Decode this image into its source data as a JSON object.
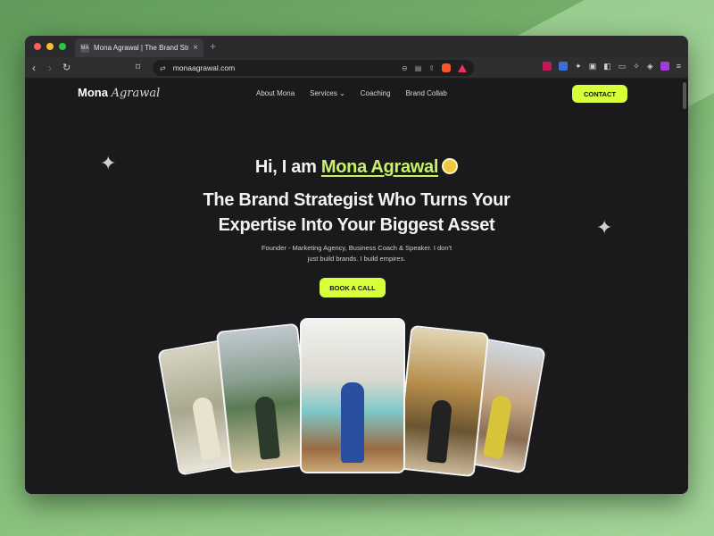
{
  "browser": {
    "tab_title": "Mona Agrawal | The Brand Strategist",
    "tab_favicon_text": "MA",
    "url": "monaagrawal.com"
  },
  "site": {
    "logo_first": "Mona",
    "logo_second": "Agrawal",
    "nav": [
      "About Mona",
      "Services ⌄",
      "Coaching",
      "Brand Collab"
    ],
    "contact_label": "CONTACT"
  },
  "hero": {
    "greeting": "Hi, I am",
    "name": "Mona Agrawal",
    "headline_line1": "The Brand Strategist Who Turns Your",
    "headline_line2": "Expertise Into Your Biggest Asset",
    "subtitle_line1": "Founder - Marketing Agency, Business Coach & Speaker. I don't",
    "subtitle_line2": "just build brands. I build empires.",
    "cta_label": "BOOK A CALL"
  },
  "colors": {
    "accent": "#d7ff3a",
    "name_highlight": "#c8f06a",
    "page_bg": "#1a1a1c"
  }
}
